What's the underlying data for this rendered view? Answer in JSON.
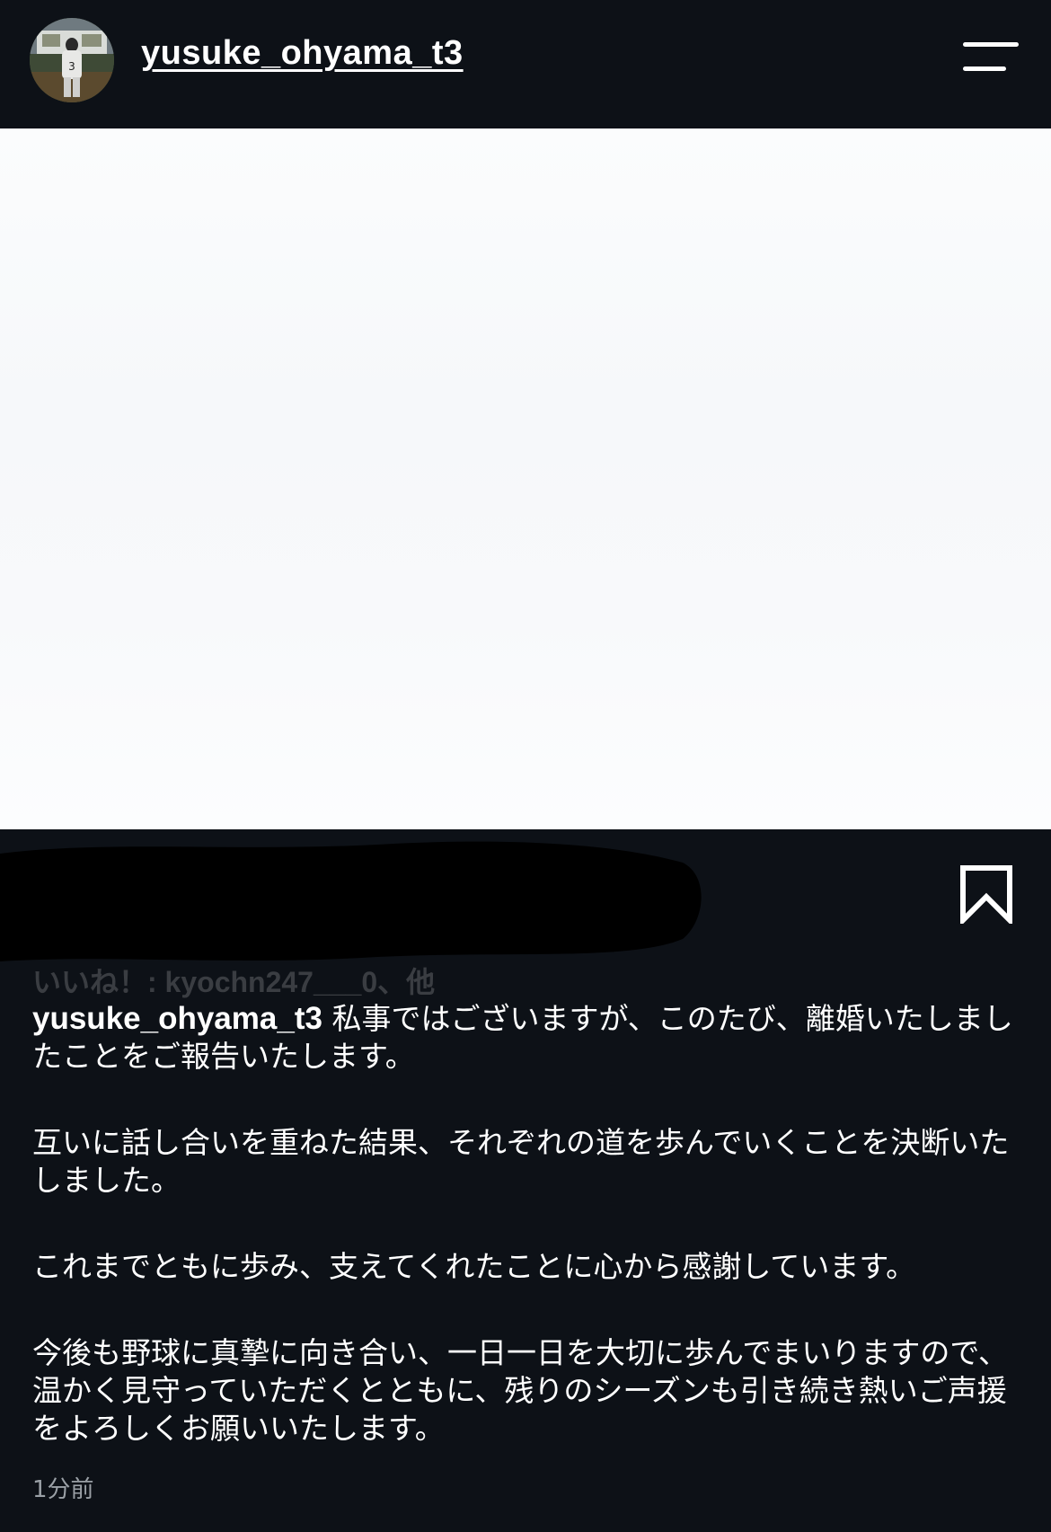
{
  "header": {
    "username": "yusuke_ohyama_t3",
    "avatar_icon": "profile-photo-baseball-player",
    "menu_icon": "hamburger-menu-icon"
  },
  "post": {
    "media_description_icon": "photo",
    "likes_text": "いいね！: kyochn247___0、他",
    "caption": {
      "username": "yusuke_ohyama_t3",
      "paragraph_1": "私事ではございますが、このたび、離婚いたしましたことをご報告いたします。",
      "paragraph_2": "互いに話し合いを重ねた結果、それぞれの道を歩んでいくことを決断いたしました。",
      "paragraph_3": "これまでともに歩み、支えてくれたことに心から感謝しています。",
      "paragraph_4": "今後も野球に真摯に向き合い、一日一日を大切に歩んでまいりますので、温かく見守っていただくとともに、残りのシーズンも引き続き熱いご声援をよろしくお願いいたします。"
    },
    "timestamp": "1分前"
  },
  "colors": {
    "background": "#0d1117",
    "text": "#ffffff",
    "muted": "#9aa0a6"
  }
}
